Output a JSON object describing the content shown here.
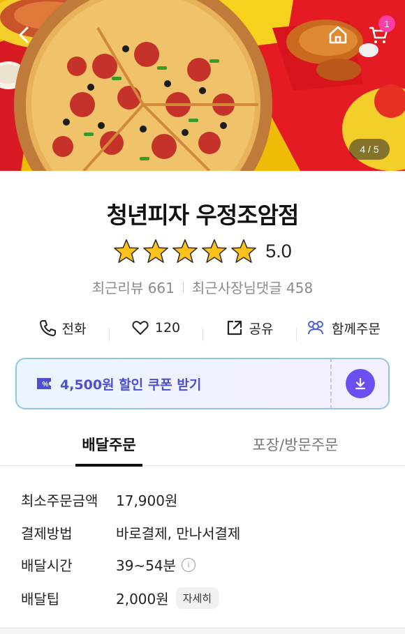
{
  "hero": {
    "page_indicator": "4 / 5",
    "cart_count": "1"
  },
  "store": {
    "name": "청년피자 우정조암점",
    "rating": "5.0",
    "stars": 5,
    "recent_reviews": "최근리뷰 661",
    "owner_replies": "최근사장님댓글 458"
  },
  "actions": {
    "call": "전화",
    "likes": "120",
    "share": "공유",
    "group_order": "함께주문"
  },
  "coupon": {
    "text": "4,500원 할인 쿠폰 받기"
  },
  "tabs": {
    "delivery": "배달주문",
    "pickup": "포장/방문주문"
  },
  "info": {
    "min_order_label": "최소주문금액",
    "min_order_value": "17,900원",
    "payment_label": "결제방법",
    "payment_value": "바로결제, 만나서결제",
    "time_label": "배달시간",
    "time_value": "39~54분",
    "tip_label": "배달팁",
    "tip_value": "2,000원",
    "detail_button": "자세히"
  },
  "colors": {
    "accent": "#6b4ff0",
    "coupon_text": "#4e4fcf",
    "star": "#ffc21a",
    "badge": "#ff3ea5"
  }
}
